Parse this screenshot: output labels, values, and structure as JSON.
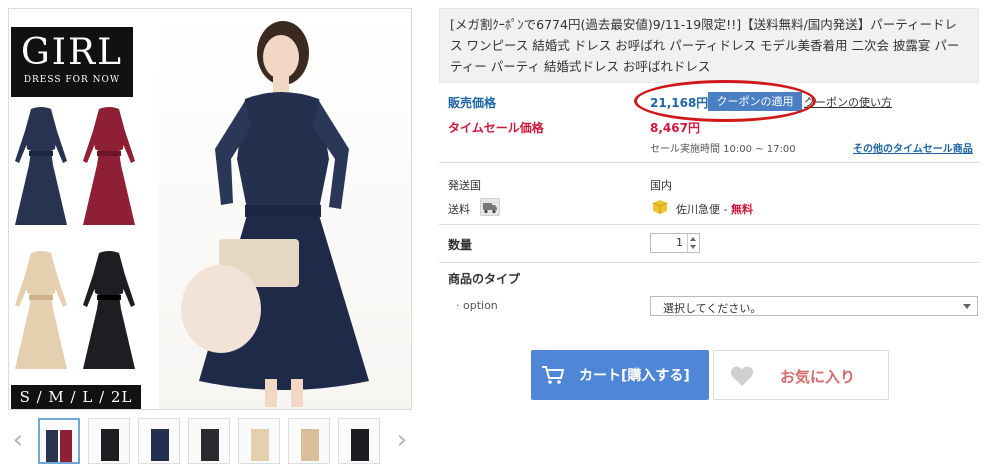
{
  "product": {
    "title": "[メガ割ｸｰﾎﾟﾝで6774円(過去最安値)9/11-19限定!!]【送料無料/国内発送】パーティードレス ワンピース 結婚式 ドレス お呼ばれ パーティドレス モデル美香着用 二次会 披露宴 パーティー パーティ 結婚式ドレス お呼ばれドレス",
    "image": {
      "brand_main": "GIRL",
      "brand_sub": "DRESS FOR NOW",
      "sizes": "S / M / L / 2L"
    }
  },
  "price": {
    "label": "販売価格",
    "value": "21,168円",
    "coupon_button": "クーポンの適用",
    "coupon_link": "クーポンの使い方"
  },
  "timesale": {
    "label": "タイムセール価格",
    "value": "8,467円",
    "time": "セール実施時間 10:00 ~ 17:00",
    "other_link": "その他のタイムセール商品"
  },
  "shipping": {
    "country_label": "発送国",
    "country_value": "国内",
    "fee_label": "送料",
    "carrier": "佐川急便 - ",
    "fee_value": "無料"
  },
  "quantity": {
    "label": "数量",
    "value": "1"
  },
  "type": {
    "label": "商品のタイプ",
    "option_label": "· option",
    "select_value": "選択してください。"
  },
  "actions": {
    "cart": "カート[購入する]",
    "favorite": "お気に入り"
  },
  "colors": {
    "accent_blue": "#4f86d6",
    "sale_red": "#d0183a",
    "annotation_red": "#d01818"
  }
}
